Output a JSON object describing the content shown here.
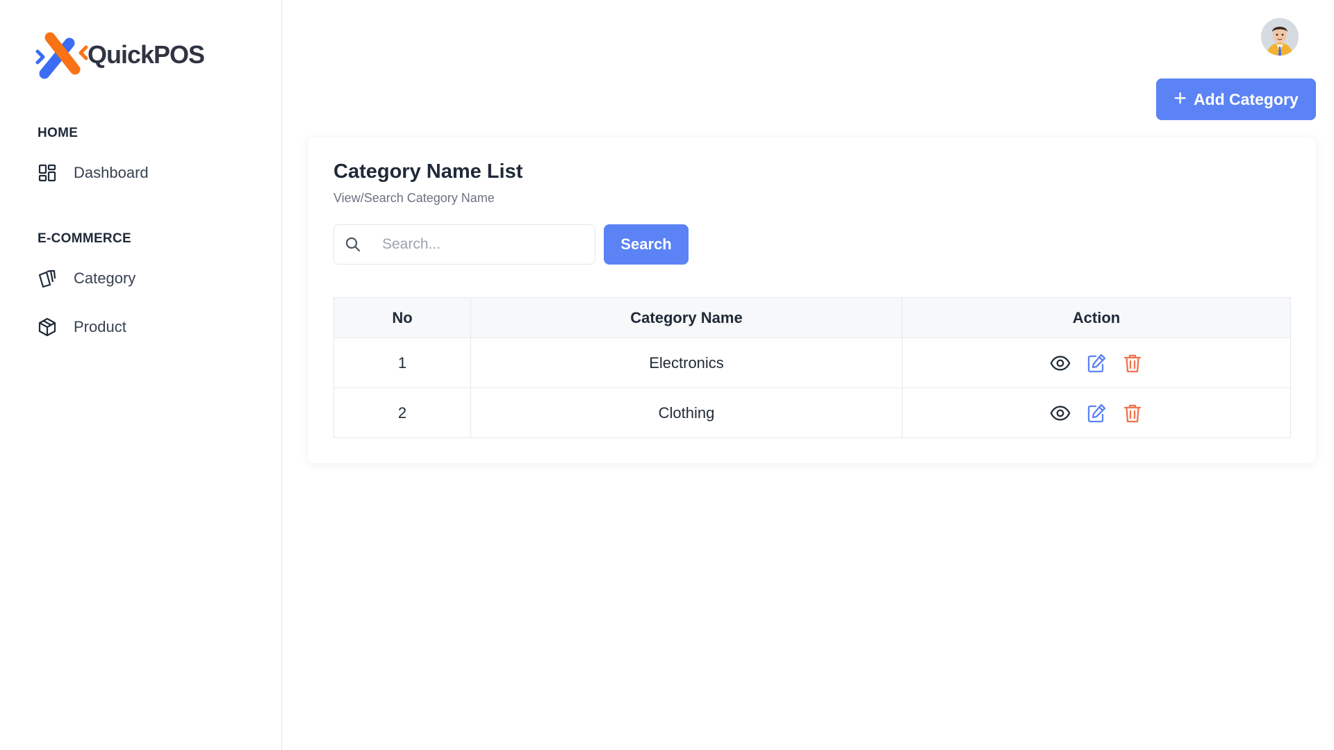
{
  "app": {
    "logo_text": "QuickPOS",
    "brand_colors": {
      "blue": "#3b6cf4",
      "orange": "#f97316",
      "accent": "#5b83f5"
    }
  },
  "sidebar": {
    "sections": [
      {
        "title": "HOME",
        "items": [
          {
            "label": "Dashboard",
            "icon": "dashboard-grid-icon"
          }
        ]
      },
      {
        "title": "E-COMMERCE",
        "items": [
          {
            "label": "Category",
            "icon": "category-tags-icon"
          },
          {
            "label": "Product",
            "icon": "box-cube-icon"
          }
        ]
      }
    ]
  },
  "header": {
    "avatar": "user-avatar",
    "add_button_label": "Add Category"
  },
  "card": {
    "title": "Category Name List",
    "subtitle": "View/Search Category Name",
    "search": {
      "placeholder": "Search...",
      "value": "",
      "button_label": "Search"
    },
    "table": {
      "headers": [
        "No",
        "Category Name",
        "Action"
      ],
      "rows": [
        {
          "no": "1",
          "name": "Electronics"
        },
        {
          "no": "2",
          "name": "Clothing"
        }
      ],
      "action_icons": [
        "eye-view-icon",
        "edit-pencil-icon",
        "trash-delete-icon"
      ],
      "action_colors": {
        "view": "#1f2937",
        "edit": "#5b83f5",
        "delete": "#f0734d"
      }
    }
  }
}
